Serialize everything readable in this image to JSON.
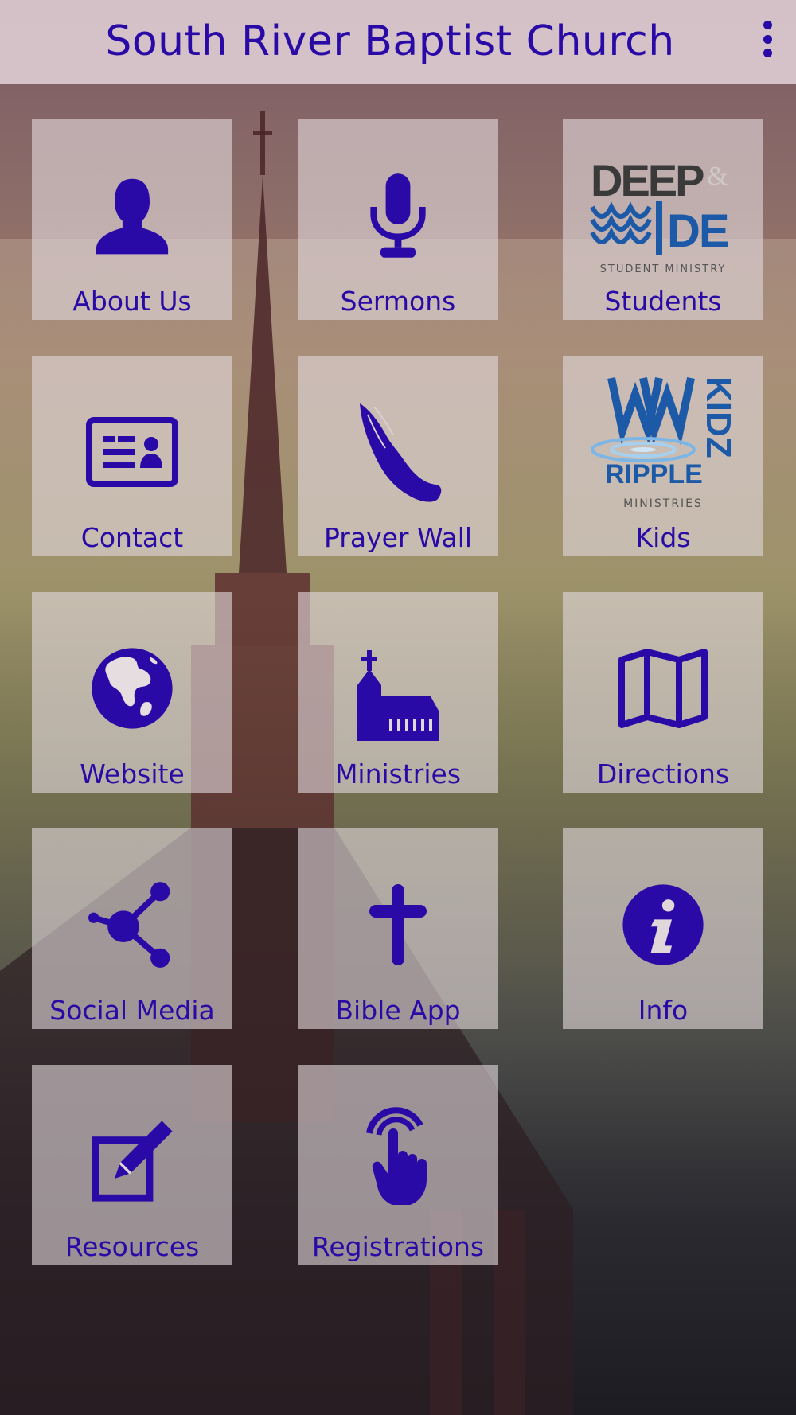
{
  "header": {
    "title": "South River Baptist Church",
    "menu_icon": "more-vertical-icon"
  },
  "tiles": [
    {
      "label": "About Us",
      "icon": "person-icon"
    },
    {
      "label": "Sermons",
      "icon": "microphone-icon"
    },
    {
      "label": "Students",
      "icon": "deep-wide-logo",
      "logo_text": {
        "line1": "DEEP",
        "amp": "&",
        "line2": "WIDE",
        "sub": "STUDENT MINISTRY"
      }
    },
    {
      "label": "Contact",
      "icon": "contact-card-icon"
    },
    {
      "label": "Prayer Wall",
      "icon": "praying-hands-icon"
    },
    {
      "label": "Kids",
      "icon": "ripple-kidz-logo",
      "logo_text": {
        "side": "KIDZ",
        "main": "RIPPLE",
        "sub": "MINISTRIES"
      }
    },
    {
      "label": "Website",
      "icon": "globe-icon"
    },
    {
      "label": "Ministries",
      "icon": "church-icon"
    },
    {
      "label": "Directions",
      "icon": "map-icon"
    },
    {
      "label": "Social Media",
      "icon": "share-icon"
    },
    {
      "label": "Bible App",
      "icon": "cross-icon"
    },
    {
      "label": "Info",
      "icon": "info-icon"
    },
    {
      "label": "Resources",
      "icon": "edit-icon"
    },
    {
      "label": "Registrations",
      "icon": "tap-icon"
    }
  ],
  "colors": {
    "accent": "#2a0aa6",
    "header_bg": "#e8d8de",
    "tile_bg": "#e1d7da"
  }
}
